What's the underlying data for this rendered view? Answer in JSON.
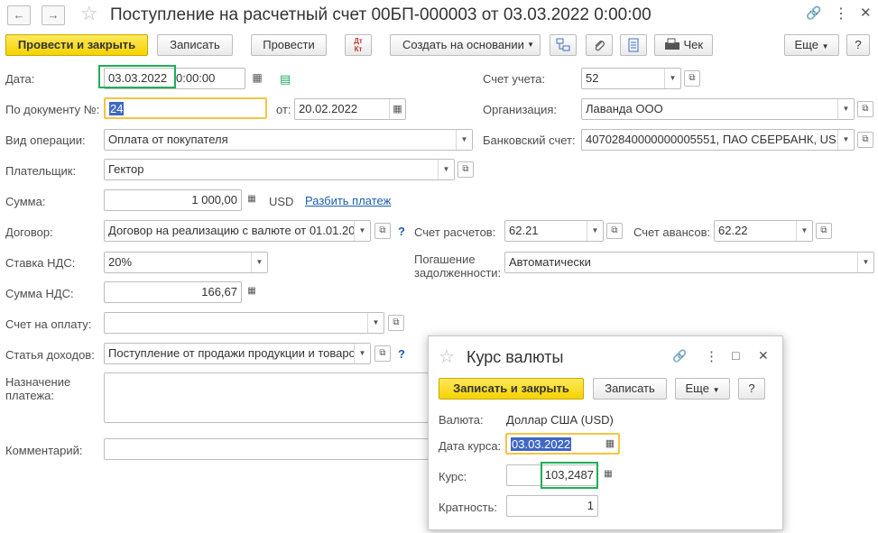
{
  "window": {
    "title": "Поступление на расчетный счет 00БП-000003 от 03.03.2022 0:00:00",
    "back_icon": "←",
    "forward_icon": "→",
    "star_icon": "☆",
    "link_icon": "🔗",
    "more_icon": "⋮",
    "maximize_icon": "□",
    "close_icon": "✕"
  },
  "toolbar": {
    "post_close": "Провести и закрыть",
    "save": "Записать",
    "post": "Провести",
    "dtkt_top": "Дт",
    "dtkt_bottom": "Кт",
    "create_based": "Создать на основании",
    "receipt": "Чек",
    "more": "Еще",
    "help": "?"
  },
  "form": {
    "date_label": "Дата:",
    "date_value": "03.03.2022",
    "time_value": "0:00:00",
    "doc_no_label": "По документу №:",
    "doc_no_value": "24",
    "from_label": "от:",
    "from_value": "20.02.2022",
    "operation_label": "Вид операции:",
    "operation_value": "Оплата от покупателя",
    "payer_label": "Плательщик:",
    "payer_value": "Гектор",
    "sum_label": "Сумма:",
    "sum_value": "1 000,00",
    "currency": "USD",
    "split_link": "Разбить платеж",
    "contract_label": "Договор:",
    "contract_value": "Договор на реализацию с валюте от 01.01.20",
    "vat_rate_label": "Ставка НДС:",
    "vat_rate_value": "20%",
    "vat_sum_label": "Сумма НДС:",
    "vat_sum_value": "166,67",
    "invoice_label": "Счет на оплату:",
    "invoice_value": "",
    "income_label": "Статья доходов:",
    "income_value": "Поступление от продажи продукции и товаро",
    "purpose_label_1": "Назначение",
    "purpose_label_2": "платежа:",
    "purpose_value": "",
    "comment_label": "Комментарий:",
    "comment_value": "",
    "account_label": "Счет учета:",
    "account_value": "52",
    "org_label": "Организация:",
    "org_value": "Лаванда ООО",
    "bank_label": "Банковский счет:",
    "bank_value": "40702840000000005551, ПАО СБЕРБАНК, US",
    "settle_label": "Счет расчетов:",
    "settle_value": "62.21",
    "advance_label": "Счет авансов:",
    "advance_value": "62.22",
    "repay_label_1": "Погашение",
    "repay_label_2": "задолженности:",
    "repay_value": "Автоматически",
    "help_q": "?"
  },
  "dialog": {
    "title": "Курс валюты",
    "save_close": "Записать и закрыть",
    "save": "Записать",
    "more": "Еще",
    "help": "?",
    "currency_label": "Валюта:",
    "currency_value": "Доллар США (USD)",
    "rate_date_label": "Дата курса:",
    "rate_date_value": "03.03.2022",
    "rate_label": "Курс:",
    "rate_value": "103,2487",
    "multiplicity_label": "Кратность:",
    "multiplicity_value": "1"
  },
  "colors": {
    "accent_yellow": "#f5d300",
    "highlight_green": "#1fae56",
    "highlight_yellow": "#f5c542",
    "link_blue": "#1b5fae",
    "selection_blue": "#3e68c2"
  }
}
